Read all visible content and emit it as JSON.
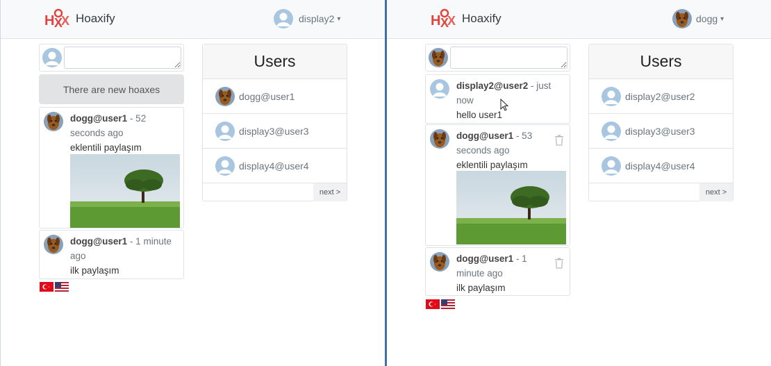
{
  "app": {
    "brand": "Hoaxify"
  },
  "left": {
    "current_user": "display2",
    "new_hoaxes_label": "There are new hoaxes",
    "hoaxes": [
      {
        "user": "dogg@user1",
        "meta1": " - 52",
        "meta2": "seconds ago",
        "content": "eklentili paylaşım"
      },
      {
        "user": "dogg@user1",
        "meta1": " - 1 minute",
        "meta2": "ago",
        "content": "ilk paylaşım"
      }
    ],
    "users": {
      "title": "Users",
      "items": [
        "dogg@user1",
        "display3@user3",
        "display4@user4"
      ],
      "next_label": "next >"
    }
  },
  "right": {
    "current_user": "dogg",
    "hoaxes": [
      {
        "user": "display2@user2",
        "meta1": " - just",
        "meta2": "now",
        "content": "hello user1"
      },
      {
        "user": "dogg@user1",
        "meta1": " - 53",
        "meta2": "seconds ago",
        "content": "eklentili paylaşım"
      },
      {
        "user": "dogg@user1",
        "meta1": " - 1",
        "meta2": "minute ago",
        "content": "ilk paylaşım"
      }
    ],
    "users": {
      "title": "Users",
      "items": [
        "display2@user2",
        "display3@user3",
        "display4@user4"
      ],
      "next_label": "next >"
    }
  },
  "colors": {
    "accent": "#e3433c",
    "divider": "#3f6fa8",
    "avatar_default": "#a8c6df"
  },
  "icons": {
    "logo": "hoaxify-logo",
    "default_avatar": "user-silhouette-icon",
    "dog_avatar": "dog-avatar",
    "trash": "trash-icon",
    "flags": [
      "turkey-flag-icon",
      "usa-flag-icon"
    ]
  }
}
